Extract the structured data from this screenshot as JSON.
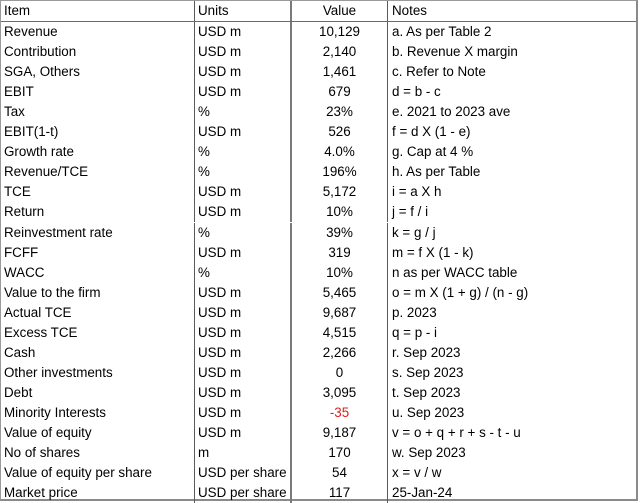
{
  "table": {
    "headers": {
      "item": "Item",
      "units": "Units",
      "value": "Value",
      "notes": "Notes"
    },
    "rows": [
      {
        "item": "Revenue",
        "units": "USD m",
        "value": "10,129",
        "notes": "a. As per Table 2"
      },
      {
        "item": "Contribution",
        "units": "USD m",
        "value": "2,140",
        "notes": "b. Revenue X margin"
      },
      {
        "item": "SGA, Others",
        "units": "USD m",
        "value": "1,461",
        "notes": "c. Refer to Note"
      },
      {
        "item": "EBIT",
        "units": "USD m",
        "value": "679",
        "notes": "d = b - c"
      },
      {
        "item": "Tax",
        "units": "%",
        "value": "23%",
        "notes": "e. 2021 to 2023 ave"
      },
      {
        "item": "EBIT(1-t)",
        "units": "USD m",
        "value": "526",
        "notes": "f = d X (1 - e)"
      },
      {
        "item": "Growth rate",
        "units": "%",
        "value": "4.0%",
        "notes": "g. Cap at 4 %"
      },
      {
        "item": "Revenue/TCE",
        "units": "%",
        "value": "196%",
        "notes": "h. As per Table"
      },
      {
        "item": "TCE",
        "units": "USD m",
        "value": "5,172",
        "notes": "i = a X h"
      },
      {
        "item": "Return",
        "units": "USD m",
        "value": "10%",
        "notes": "j = f / i"
      },
      {
        "item": "Reinvestment rate",
        "units": "%",
        "value": "39%",
        "notes": "k = g / j"
      },
      {
        "item": "FCFF",
        "units": "USD m",
        "value": "319",
        "notes": "m = f X (1 - k)"
      },
      {
        "item": "WACC",
        "units": "%",
        "value": "10%",
        "notes": "n as per WACC table"
      },
      {
        "item": "Value to the firm",
        "units": "USD m",
        "value": "5,465",
        "notes": "o = m X (1 + g) / (n - g)"
      },
      {
        "item": "Actual TCE",
        "units": "USD m",
        "value": "9,687",
        "notes": "p. 2023"
      },
      {
        "item": "Excess TCE",
        "units": "USD m",
        "value": "4,515",
        "notes": "q = p - i"
      },
      {
        "item": "Cash",
        "units": "USD m",
        "value": "2,266",
        "notes": "r. Sep 2023"
      },
      {
        "item": "Other investments",
        "units": "USD m",
        "value": "0",
        "notes": "s. Sep 2023"
      },
      {
        "item": "Debt",
        "units": "USD m",
        "value": "3,095",
        "notes": "t. Sep 2023"
      },
      {
        "item": "Minority Interests",
        "units": "USD m",
        "value": "-35",
        "notes": "u. Sep 2023",
        "negative": true
      },
      {
        "item": "Value of equity",
        "units": "USD m",
        "value": "9,187",
        "notes": "v = o + q + r + s - t - u"
      },
      {
        "item": "No of shares",
        "units": "m",
        "value": "170",
        "notes": "w. Sep 2023"
      },
      {
        "item": "Value of equity per share",
        "units": "USD per share",
        "value": "54",
        "notes": "x = v / w"
      },
      {
        "item": "Market price",
        "units": "USD per share",
        "value": "117",
        "notes": "25-Jan-24"
      }
    ]
  },
  "colors": {
    "negative": "#e0201c",
    "grid": "#5a5a5a"
  }
}
